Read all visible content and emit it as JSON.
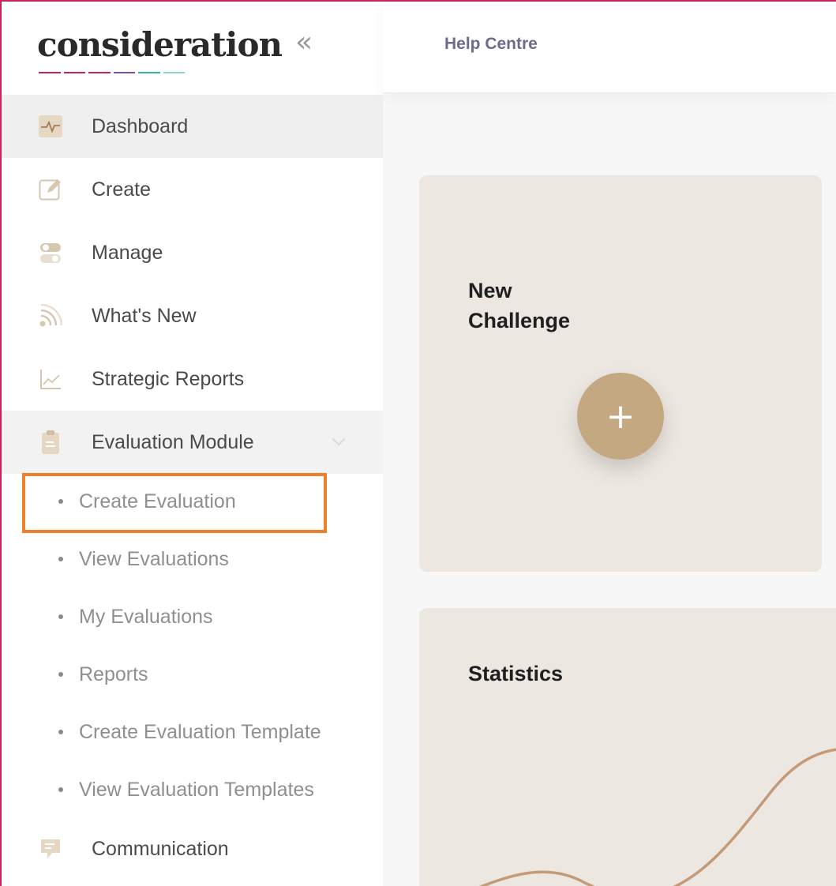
{
  "brand": {
    "logo_text": "consideration",
    "collapse_glyph": "«",
    "underline_colors": [
      "#c8245a",
      "#c8245a",
      "#c8245a",
      "#7a4fa3",
      "#35b5a8",
      "#8fd3cc"
    ]
  },
  "sidebar": {
    "items": [
      {
        "label": "Dashboard",
        "icon": "pulse-icon"
      },
      {
        "label": "Create",
        "icon": "edit-icon"
      },
      {
        "label": "Manage",
        "icon": "toggle-icon"
      },
      {
        "label": "What's New",
        "icon": "rss-icon"
      },
      {
        "label": "Strategic Reports",
        "icon": "line-chart-icon"
      },
      {
        "label": "Evaluation Module",
        "icon": "clipboard-icon"
      },
      {
        "label": "Communication",
        "icon": "chat-icon"
      }
    ],
    "evaluation_submenu": [
      {
        "label": "Create Evaluation"
      },
      {
        "label": "View Evaluations"
      },
      {
        "label": "My Evaluations"
      },
      {
        "label": "Reports"
      },
      {
        "label": "Create Evaluation Template"
      },
      {
        "label": "View Evaluation Templates"
      }
    ]
  },
  "topbar": {
    "help_label": "Help Centre"
  },
  "cards": {
    "new_challenge_title": "New\nChallenge",
    "new_challenge_button": "+",
    "statistics_title": "Statistics"
  },
  "colors": {
    "accent": "#c3a881",
    "card_bg": "#ece7e0",
    "highlight": "#ef7f2a",
    "frame": "#c8245a",
    "curve": "#c49a78"
  }
}
